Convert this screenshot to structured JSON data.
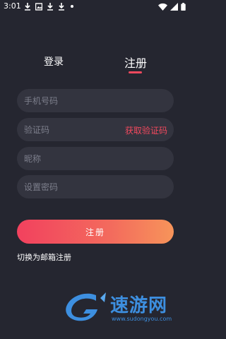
{
  "status_bar": {
    "time": "3:01",
    "left_icons": [
      "download-icon",
      "image-icon",
      "download-icon",
      "download-icon",
      "dot-icon"
    ],
    "right_icons": [
      "wifi-icon",
      "signal-icon",
      "battery-icon"
    ]
  },
  "tabs": {
    "login": "登录",
    "register": "注册",
    "active": "register",
    "accent_color": "#f2495e"
  },
  "form": {
    "phone_placeholder": "手机号码",
    "code_placeholder": "验证码",
    "get_code_label": "获取验证码",
    "nickname_placeholder": "昵称",
    "password_placeholder": "设置密码"
  },
  "register_button": {
    "label": "注册"
  },
  "switch_link": "切换为邮箱注册",
  "watermark": {
    "text": "速游网",
    "sub": "www.sudongyou.com"
  },
  "colors": {
    "background": "#252630",
    "field": "#33343f",
    "button_gradient_start": "#f2415e",
    "button_gradient_end": "#f7945a"
  }
}
